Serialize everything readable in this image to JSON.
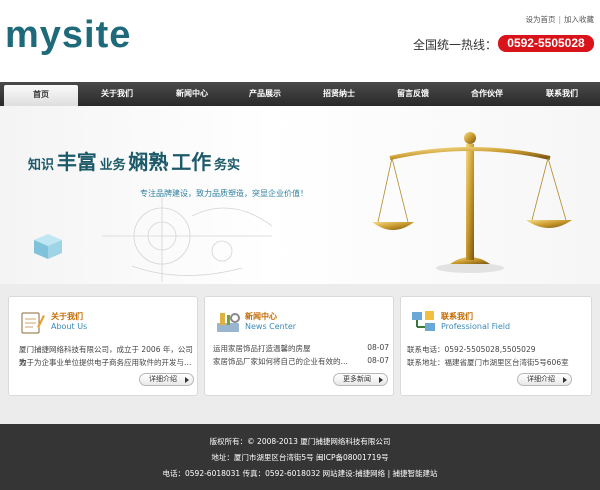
{
  "header": {
    "logo": "mysite",
    "top_links": [
      "设为首页",
      "加入收藏"
    ],
    "hotline_label": "全国统一热线：",
    "hotline_number": "0592-5505028"
  },
  "nav": {
    "items": [
      "首页",
      "关于我们",
      "新闻中心",
      "产品展示",
      "招贤纳士",
      "留言反馈",
      "合作伙伴",
      "联系我们"
    ],
    "active_index": 0
  },
  "banner": {
    "slogan": [
      "知识",
      "丰富",
      "业务",
      "娴熟",
      "工作",
      "务实"
    ],
    "sub_slogan": "专注品牌建设，致力品质塑造，突显企业价值！"
  },
  "about": {
    "title": "关于我们",
    "title_en": "About Us",
    "text_line1": "厦门捕捷网络科技有限公司，成立于 2006 年，公司致",
    "text_line2": "力于为企事业单位提供电子商务应用软件的开发与…",
    "button": "详细介绍"
  },
  "news": {
    "title": "新闻中心",
    "title_en": "News Center",
    "items": [
      {
        "title": "运用家居饰品打造温馨的房屋",
        "date": "08-07"
      },
      {
        "title": "家居饰品厂家如何将自己的企业有效的…",
        "date": "08-07"
      }
    ],
    "button": "更多新闻"
  },
  "contact": {
    "title": "联系我们",
    "title_en": "Professional Field",
    "phone": "联系电话：0592-5505028,5505029",
    "address": "联系地址：福建省厦门市湖里区台湾街5号606室",
    "button": "详细介绍"
  },
  "footer": {
    "line1": "版权所有：© 2008-2013 厦门捕捷网络科技有限公司",
    "line2": "地址：厦门市湖里区台湾街5号 闽ICP备08001719号",
    "line3": "电话：0592-6018031  传真：0592-6018032 网站建设:捕捷网络 | 捕捷智能建站"
  },
  "colors": {
    "brand": "#1f6a7a",
    "hotline_red": "#d8141a",
    "nav_dark": "#333333",
    "section_title": "#c26a00",
    "subtitle_blue": "#3a8ab8"
  }
}
